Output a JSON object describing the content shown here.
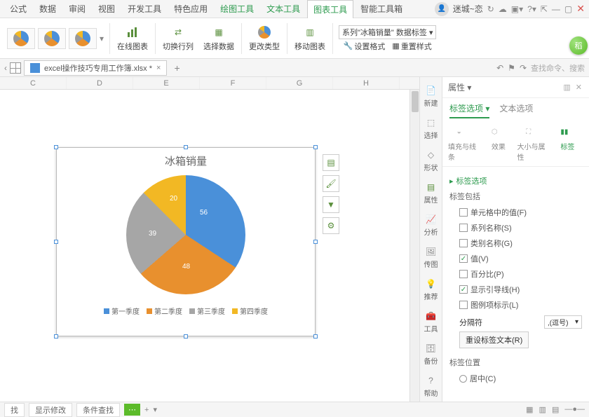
{
  "menu": {
    "items": [
      "公式",
      "数据",
      "审阅",
      "视图",
      "开发工具",
      "特色应用",
      "绘图工具",
      "文本工具",
      "图表工具",
      "智能工具箱"
    ],
    "active_index": 8,
    "green_from": 6
  },
  "user": {
    "name": "迷城~恋"
  },
  "ribbon": {
    "online_chart": "在线图表",
    "switch_rc": "切换行列",
    "select_data": "选择数据",
    "change_type": "更改类型",
    "move_chart": "移动图表",
    "series_dd": "系列\"冰箱销量\" 数据标签",
    "set_format": "设置格式",
    "reset_style": "重置样式"
  },
  "filetab": {
    "name": "excel操作技巧专用工作簿.xlsx *"
  },
  "search_placeholder": "查找命令、搜索",
  "columns": [
    "C",
    "D",
    "E",
    "F",
    "G",
    "H"
  ],
  "chart_data": {
    "type": "pie",
    "title": "冰箱销量",
    "categories": [
      "第一季度",
      "第二季度",
      "第三季度",
      "第四季度"
    ],
    "values": [
      56,
      48,
      39,
      20
    ],
    "colors": [
      "#4a90d9",
      "#e8902e",
      "#a6a6a6",
      "#f2b824"
    ]
  },
  "float_tools": [
    "chart-element",
    "brush",
    "filter",
    "settings"
  ],
  "dock": [
    {
      "label": "新建",
      "name": "new"
    },
    {
      "label": "选择",
      "name": "select"
    },
    {
      "label": "形状",
      "name": "shape"
    },
    {
      "label": "属性",
      "name": "properties",
      "active": true
    },
    {
      "label": "分析",
      "name": "analyze"
    },
    {
      "label": "传图",
      "name": "image"
    },
    {
      "label": "推荐",
      "name": "recommend"
    },
    {
      "label": "工具",
      "name": "tools"
    },
    {
      "label": "备份",
      "name": "backup"
    },
    {
      "label": "帮助",
      "name": "help"
    }
  ],
  "props": {
    "title": "属性",
    "tabs": [
      "标签选项",
      "文本选项"
    ],
    "subtabs": [
      "填充与线条",
      "效果",
      "大小与属性",
      "标签"
    ],
    "section": "标签选项",
    "contains_head": "标签包括",
    "checks": [
      {
        "label": "单元格中的值(F)",
        "on": false
      },
      {
        "label": "系列名称(S)",
        "on": false
      },
      {
        "label": "类别名称(G)",
        "on": false
      },
      {
        "label": "值(V)",
        "on": true
      },
      {
        "label": "百分比(P)",
        "on": false
      },
      {
        "label": "显示引导线(H)",
        "on": true
      },
      {
        "label": "图例项标示(L)",
        "on": false
      }
    ],
    "separator_label": "分隔符",
    "separator_value": ",(逗号)",
    "reset_label": "重设标签文本(R)",
    "position_head": "标签位置",
    "position_opt": "居中(C)"
  },
  "statusbar": {
    "find": "找",
    "show_rev": "显示修改",
    "cond_find": "条件查找"
  }
}
